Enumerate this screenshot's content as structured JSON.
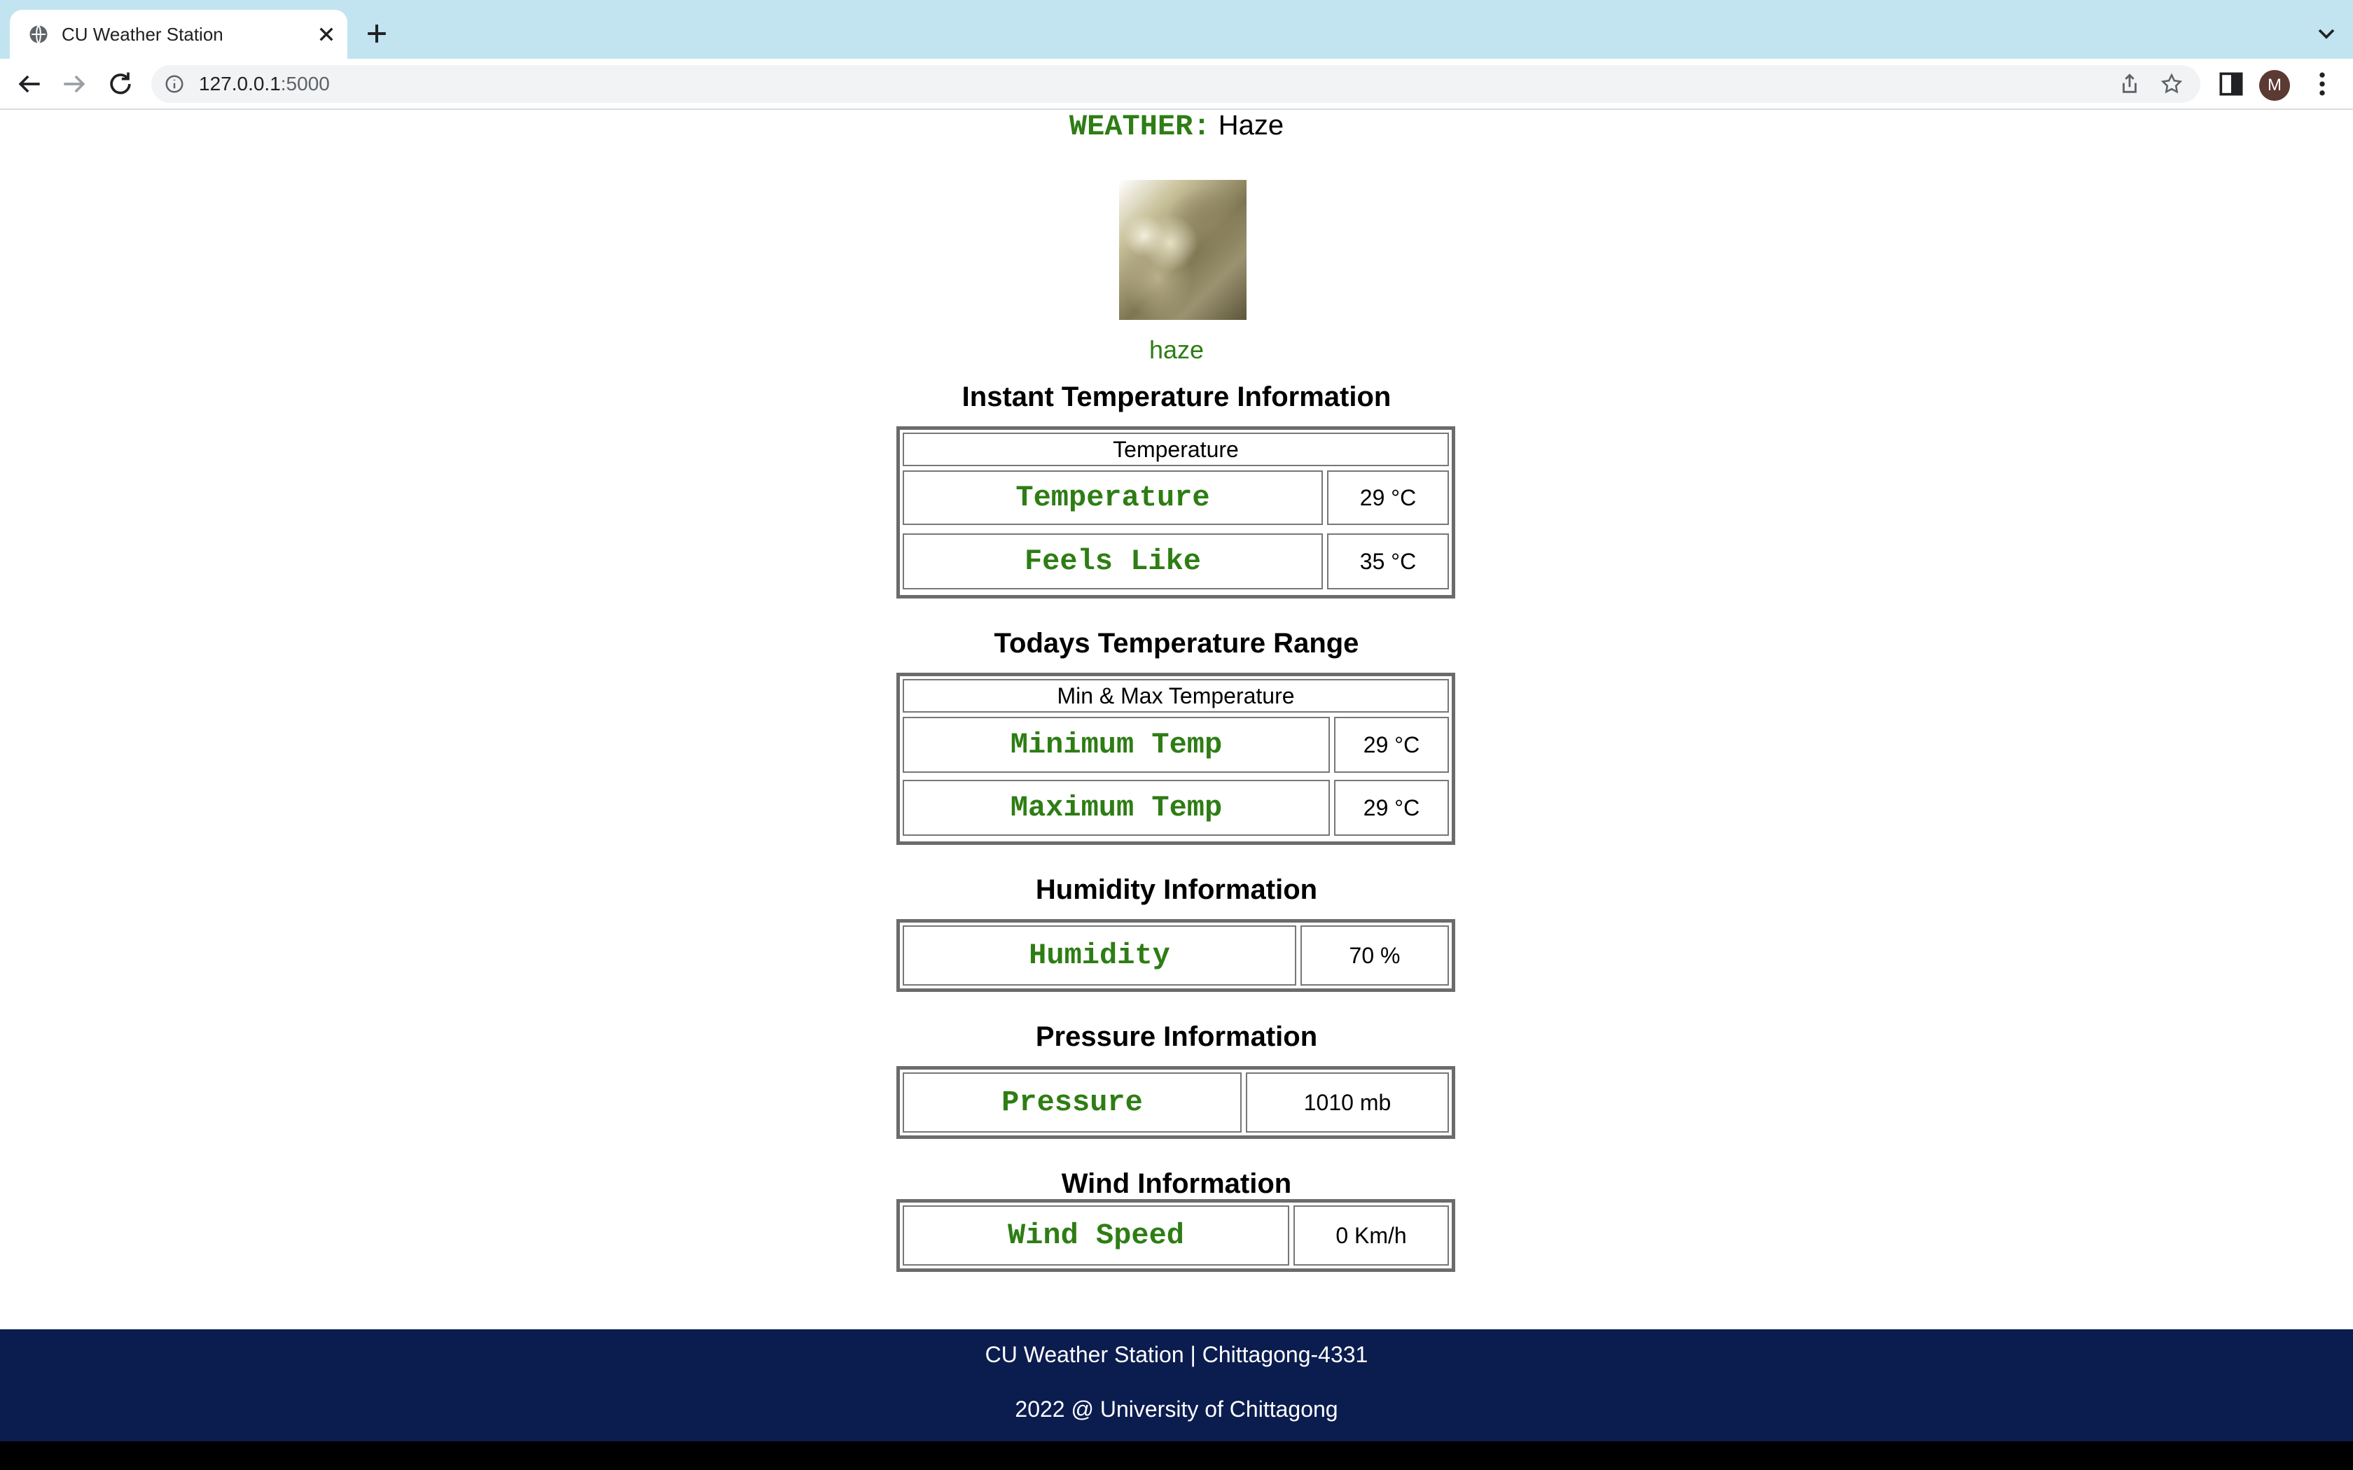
{
  "browser": {
    "tab_title": "CU Weather Station",
    "url_host": "127.0.0.1",
    "url_port": ":5000",
    "avatar_letter": "M"
  },
  "weather": {
    "label": "WEATHER:",
    "value": "Haze",
    "icon_description": "haze"
  },
  "sections": {
    "instant": {
      "title": "Instant Temperature Information",
      "caption": "Temperature",
      "rows": [
        {
          "label": "Temperature",
          "value": "29 °C"
        },
        {
          "label": "Feels Like",
          "value": "35 °C"
        }
      ]
    },
    "range": {
      "title": "Todays Temperature Range",
      "caption": "Min & Max Temperature",
      "rows": [
        {
          "label": "Minimum Temp",
          "value": "29 °C"
        },
        {
          "label": "Maximum Temp",
          "value": "29 °C"
        }
      ]
    },
    "humidity": {
      "title": "Humidity Information",
      "rows": [
        {
          "label": "Humidity",
          "value": "70 %"
        }
      ]
    },
    "pressure": {
      "title": "Pressure Information",
      "rows": [
        {
          "label": "Pressure",
          "value": "1010 mb"
        }
      ]
    },
    "wind": {
      "title": "Wind Information",
      "rows": [
        {
          "label": "Wind Speed",
          "value": "0 Km/h"
        }
      ]
    }
  },
  "footer": {
    "line1": "CU Weather Station | Chittagong-4331",
    "line2": "2022 @ University of Chittagong"
  },
  "colors": {
    "accent_green": "#2e7d14",
    "footer_bg": "#0b1c4f",
    "tabbar_bg": "#c1e4f0"
  }
}
